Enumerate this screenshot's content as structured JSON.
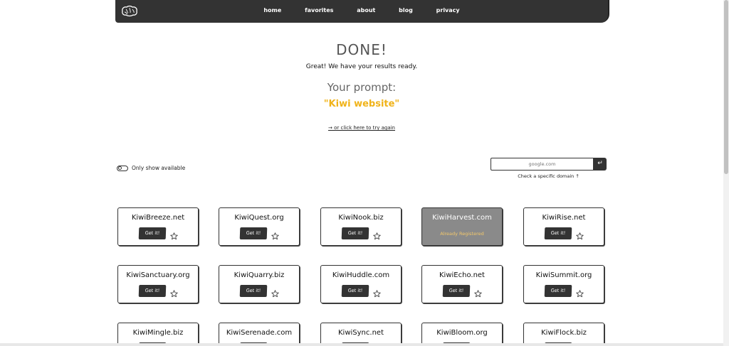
{
  "nav": {
    "logo_icon": "brain-icon",
    "links": [
      "home",
      "favorites",
      "about",
      "blog",
      "privacy"
    ]
  },
  "result": {
    "heading": "DONE!",
    "subtext": "Great! We have your results ready.",
    "prompt_label": "Your prompt:",
    "prompt_value": "\"Kiwi website\"",
    "retry_link": "→ or click here to try again"
  },
  "filters": {
    "toggle_label": "Only show available",
    "toggle_on": false,
    "domain_placeholder": "google.com",
    "domain_button_icon": "enter-arrow-icon",
    "domain_button_glyph": "↵",
    "domain_help": "Check a specific domain ↑"
  },
  "domains": [
    {
      "name": "KiwiBreeze.net",
      "registered": false
    },
    {
      "name": "KiwiQuest.org",
      "registered": false
    },
    {
      "name": "KiwiNook.biz",
      "registered": false
    },
    {
      "name": "KiwiHarvest.com",
      "registered": true
    },
    {
      "name": "KiwiRise.net",
      "registered": false
    },
    {
      "name": "KiwiSanctuary.org",
      "registered": false
    },
    {
      "name": "KiwiQuarry.biz",
      "registered": false
    },
    {
      "name": "KiwiHuddle.com",
      "registered": false
    },
    {
      "name": "KiwiEcho.net",
      "registered": false
    },
    {
      "name": "KiwiSummit.org",
      "registered": false
    },
    {
      "name": "KiwiMingle.biz",
      "registered": false
    },
    {
      "name": "KiwiSerenade.com",
      "registered": false
    },
    {
      "name": "KiwiSync.net",
      "registered": false
    },
    {
      "name": "KiwiBloom.org",
      "registered": false
    },
    {
      "name": "KiwiFlock.biz",
      "registered": false
    }
  ],
  "card_labels": {
    "get_button": "Get it!",
    "registered_status": "Already Registered",
    "star_icon": "star-outline-icon"
  },
  "colors": {
    "dark": "#333333",
    "accent": "#f0b31a",
    "registered_bg": "#8a8a8a",
    "registered_text": "#f3c86b"
  }
}
